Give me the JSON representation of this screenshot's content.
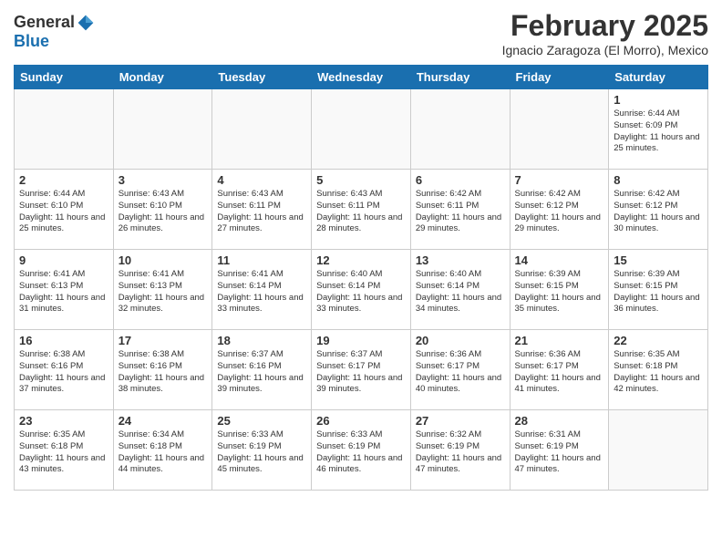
{
  "logo": {
    "general": "General",
    "blue": "Blue"
  },
  "title": "February 2025",
  "location": "Ignacio Zaragoza (El Morro), Mexico",
  "days_header": [
    "Sunday",
    "Monday",
    "Tuesday",
    "Wednesday",
    "Thursday",
    "Friday",
    "Saturday"
  ],
  "weeks": [
    [
      {
        "day": "",
        "info": ""
      },
      {
        "day": "",
        "info": ""
      },
      {
        "day": "",
        "info": ""
      },
      {
        "day": "",
        "info": ""
      },
      {
        "day": "",
        "info": ""
      },
      {
        "day": "",
        "info": ""
      },
      {
        "day": "1",
        "info": "Sunrise: 6:44 AM\nSunset: 6:09 PM\nDaylight: 11 hours and 25 minutes."
      }
    ],
    [
      {
        "day": "2",
        "info": "Sunrise: 6:44 AM\nSunset: 6:10 PM\nDaylight: 11 hours and 25 minutes."
      },
      {
        "day": "3",
        "info": "Sunrise: 6:43 AM\nSunset: 6:10 PM\nDaylight: 11 hours and 26 minutes."
      },
      {
        "day": "4",
        "info": "Sunrise: 6:43 AM\nSunset: 6:11 PM\nDaylight: 11 hours and 27 minutes."
      },
      {
        "day": "5",
        "info": "Sunrise: 6:43 AM\nSunset: 6:11 PM\nDaylight: 11 hours and 28 minutes."
      },
      {
        "day": "6",
        "info": "Sunrise: 6:42 AM\nSunset: 6:11 PM\nDaylight: 11 hours and 29 minutes."
      },
      {
        "day": "7",
        "info": "Sunrise: 6:42 AM\nSunset: 6:12 PM\nDaylight: 11 hours and 29 minutes."
      },
      {
        "day": "8",
        "info": "Sunrise: 6:42 AM\nSunset: 6:12 PM\nDaylight: 11 hours and 30 minutes."
      }
    ],
    [
      {
        "day": "9",
        "info": "Sunrise: 6:41 AM\nSunset: 6:13 PM\nDaylight: 11 hours and 31 minutes."
      },
      {
        "day": "10",
        "info": "Sunrise: 6:41 AM\nSunset: 6:13 PM\nDaylight: 11 hours and 32 minutes."
      },
      {
        "day": "11",
        "info": "Sunrise: 6:41 AM\nSunset: 6:14 PM\nDaylight: 11 hours and 33 minutes."
      },
      {
        "day": "12",
        "info": "Sunrise: 6:40 AM\nSunset: 6:14 PM\nDaylight: 11 hours and 33 minutes."
      },
      {
        "day": "13",
        "info": "Sunrise: 6:40 AM\nSunset: 6:14 PM\nDaylight: 11 hours and 34 minutes."
      },
      {
        "day": "14",
        "info": "Sunrise: 6:39 AM\nSunset: 6:15 PM\nDaylight: 11 hours and 35 minutes."
      },
      {
        "day": "15",
        "info": "Sunrise: 6:39 AM\nSunset: 6:15 PM\nDaylight: 11 hours and 36 minutes."
      }
    ],
    [
      {
        "day": "16",
        "info": "Sunrise: 6:38 AM\nSunset: 6:16 PM\nDaylight: 11 hours and 37 minutes."
      },
      {
        "day": "17",
        "info": "Sunrise: 6:38 AM\nSunset: 6:16 PM\nDaylight: 11 hours and 38 minutes."
      },
      {
        "day": "18",
        "info": "Sunrise: 6:37 AM\nSunset: 6:16 PM\nDaylight: 11 hours and 39 minutes."
      },
      {
        "day": "19",
        "info": "Sunrise: 6:37 AM\nSunset: 6:17 PM\nDaylight: 11 hours and 39 minutes."
      },
      {
        "day": "20",
        "info": "Sunrise: 6:36 AM\nSunset: 6:17 PM\nDaylight: 11 hours and 40 minutes."
      },
      {
        "day": "21",
        "info": "Sunrise: 6:36 AM\nSunset: 6:17 PM\nDaylight: 11 hours and 41 minutes."
      },
      {
        "day": "22",
        "info": "Sunrise: 6:35 AM\nSunset: 6:18 PM\nDaylight: 11 hours and 42 minutes."
      }
    ],
    [
      {
        "day": "23",
        "info": "Sunrise: 6:35 AM\nSunset: 6:18 PM\nDaylight: 11 hours and 43 minutes."
      },
      {
        "day": "24",
        "info": "Sunrise: 6:34 AM\nSunset: 6:18 PM\nDaylight: 11 hours and 44 minutes."
      },
      {
        "day": "25",
        "info": "Sunrise: 6:33 AM\nSunset: 6:19 PM\nDaylight: 11 hours and 45 minutes."
      },
      {
        "day": "26",
        "info": "Sunrise: 6:33 AM\nSunset: 6:19 PM\nDaylight: 11 hours and 46 minutes."
      },
      {
        "day": "27",
        "info": "Sunrise: 6:32 AM\nSunset: 6:19 PM\nDaylight: 11 hours and 47 minutes."
      },
      {
        "day": "28",
        "info": "Sunrise: 6:31 AM\nSunset: 6:19 PM\nDaylight: 11 hours and 47 minutes."
      },
      {
        "day": "",
        "info": ""
      }
    ]
  ]
}
